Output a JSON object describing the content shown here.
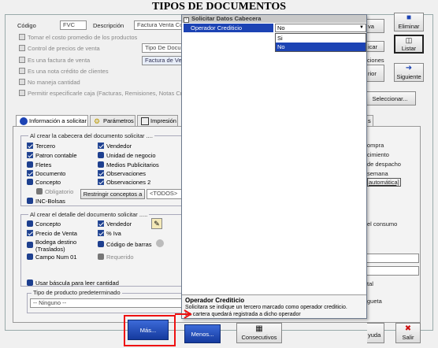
{
  "window": {
    "title": "TIPOS DE DOCUMENTOS"
  },
  "header": {
    "codigo_label": "Código",
    "codigo_value": "FVC",
    "descripcion_label": "Descripción",
    "descripcion_value": "Factura Venta Con",
    "tipo_value": "Tipo De Docum",
    "factura_value": "Factura de Ven"
  },
  "options": [
    {
      "label": "Tomar el costo promedio de los productos",
      "checked": true,
      "disabled": true
    },
    {
      "label": "Control de precios de venta",
      "checked": true,
      "disabled": true
    },
    {
      "label": "Es una factura de venta",
      "checked": true,
      "disabled": true
    },
    {
      "label": "Es una nota crédito de clientes",
      "checked": false,
      "disabled": true
    },
    {
      "label": "No maneja cantidad",
      "checked": false,
      "disabled": true
    },
    {
      "label": "Permitir especificarle caja  (Facturas, Remisiones, Notas Cr",
      "checked": true,
      "disabled": true
    }
  ],
  "right_buttons": {
    "eliminar": "Eliminar",
    "listar": "Listar",
    "siguiente": "Siguiente",
    "seleccionar": "Seleccionar...",
    "nueva": "va",
    "modificar": "icar",
    "anterior": "rior",
    "opciones": "ciones"
  },
  "tabs": {
    "info": "Información a solicitar",
    "parametros": "Parámetros",
    "impresion": "Impresión",
    "other": "s"
  },
  "cabecera_group": {
    "title": "Al crear la cabecera del documento solicitar ....",
    "col1": [
      "Tercero",
      "Patron contable",
      "Fletes",
      "Documento",
      "Concepto"
    ],
    "col2": [
      "Vendedor",
      "Unidad de negocio",
      "Medios Publicitarios",
      "Observaciones",
      "Observaciones 2"
    ],
    "obligatorio": "Obligatorio",
    "restringir": "Restringir conceptos a",
    "todos": "<TODOS>",
    "inc_bolsas": "INC-Bolsas"
  },
  "right_texts": [
    "ompra",
    "cimiento",
    "de despacho",
    "semana",
    "automática]"
  ],
  "detalle_group": {
    "title": "Al crear  el detalle del documento solicitar .....",
    "col1": [
      "Concepto",
      "Precio de Venta",
      "Bodega destino (Traslados)",
      "Campo Num 01"
    ],
    "col2": [
      "Vendedor",
      "% Iva",
      "Código de barras",
      "Requerido"
    ],
    "bascula": "Usar báscula para leer cantidad",
    "consumo": "el consumo",
    "tal": "tal",
    "gueta": "gueta"
  },
  "tipo_producto": {
    "label": "Tipo de producto predeterminado",
    "value": "-- Ninguno --"
  },
  "popup": {
    "header": "Solicitar Datos Cabecera",
    "prop_name": "Operador Crediticio",
    "prop_value": "No",
    "options": [
      "Si",
      "No"
    ],
    "desc_title": "Operador Crediticio",
    "desc_line1": "Solicitara se indique un tercero marcado como operador crediticio.",
    "desc_line2": "La cartera quedará registrada a dicho operador"
  },
  "bottom": {
    "mas": "Más...",
    "menos": "Menos...",
    "consecutivos": "Consecutivos",
    "ayuda": "yuda",
    "salir": "Salir"
  }
}
